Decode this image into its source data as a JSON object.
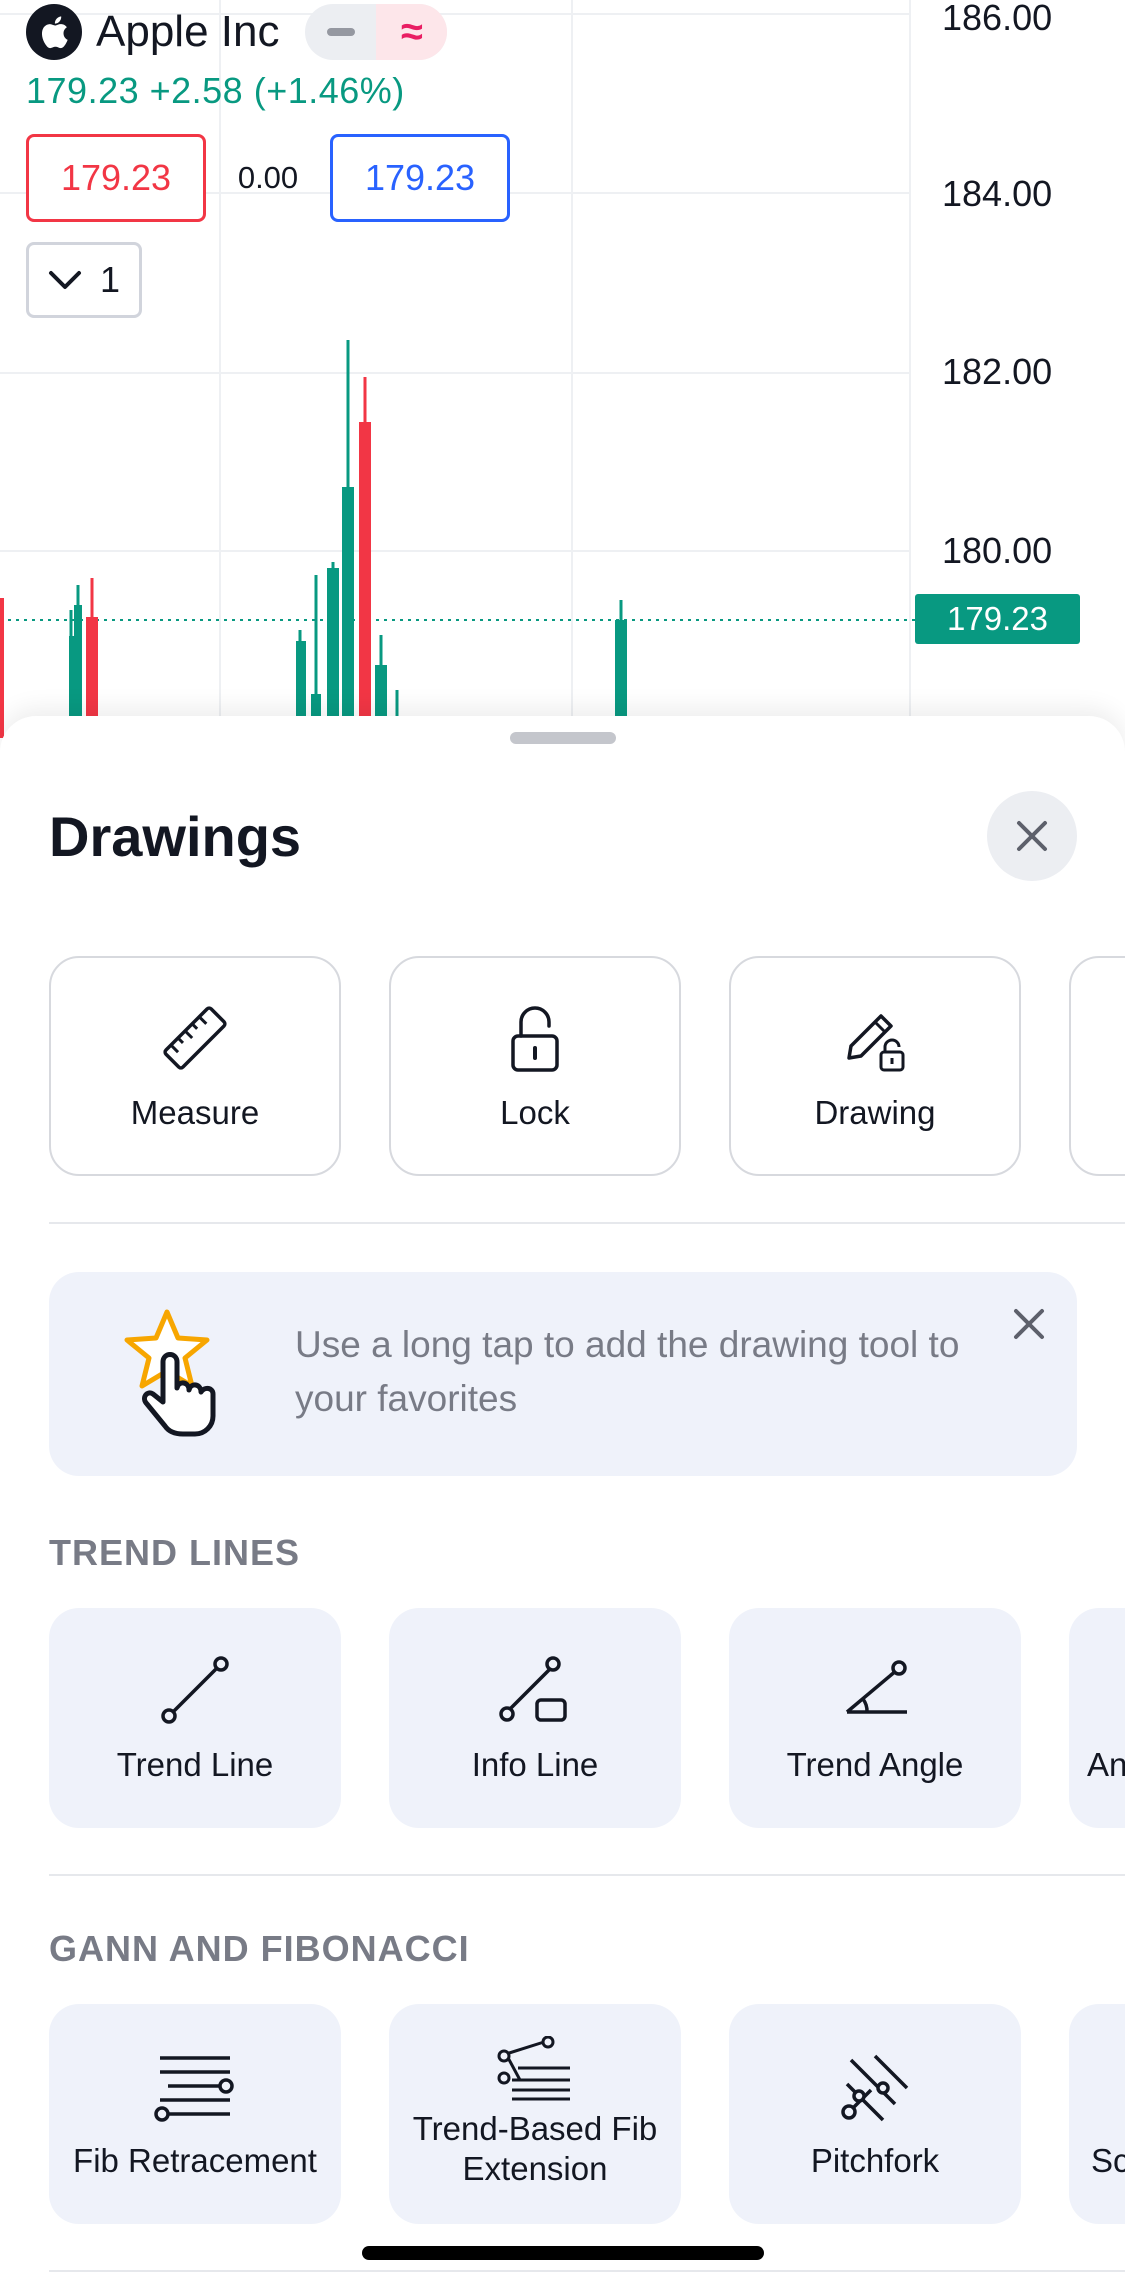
{
  "chart": {
    "symbol": "Apple Inc",
    "quote": "179.23  +2.58 (+1.46%)",
    "sell_price": "179.23",
    "spread": "0.00",
    "buy_price": "179.23",
    "quantity": "1",
    "price_labels": [
      "186.00",
      "184.00",
      "182.00",
      "180.00"
    ],
    "last_price": "179.23",
    "colors": {
      "up": "#089981",
      "down": "#f23645",
      "accent": "#e91e63",
      "buy": "#2962ff"
    }
  },
  "sheet": {
    "title": "Drawings",
    "quick_actions": [
      {
        "label": "Measure",
        "icon": "ruler-icon"
      },
      {
        "label": "Lock",
        "icon": "unlocked-padlock-icon"
      },
      {
        "label": "Drawing",
        "icon": "pencil-lock-icon"
      }
    ],
    "hint": {
      "text": "Use a long tap to add the drawing tool to your favorites",
      "icon": "star-tap-icon"
    },
    "sections": [
      {
        "title": "TREND LINES",
        "tools": [
          {
            "label": "Trend Line",
            "icon": "trend-line-icon"
          },
          {
            "label": "Info Line",
            "icon": "info-line-icon"
          },
          {
            "label": "Trend Angle",
            "icon": "trend-angle-icon"
          },
          {
            "label": "An",
            "icon": ""
          }
        ]
      },
      {
        "title": "GANN AND FIBONACCI",
        "tools": [
          {
            "label": "Fib Retracement",
            "icon": "fib-retracement-icon"
          },
          {
            "label": "Trend-Based Fib Extension",
            "icon": "fib-extension-icon"
          },
          {
            "label": "Pitchfork",
            "icon": "pitchfork-icon"
          },
          {
            "label": "Sc",
            "icon": ""
          }
        ]
      }
    ]
  }
}
